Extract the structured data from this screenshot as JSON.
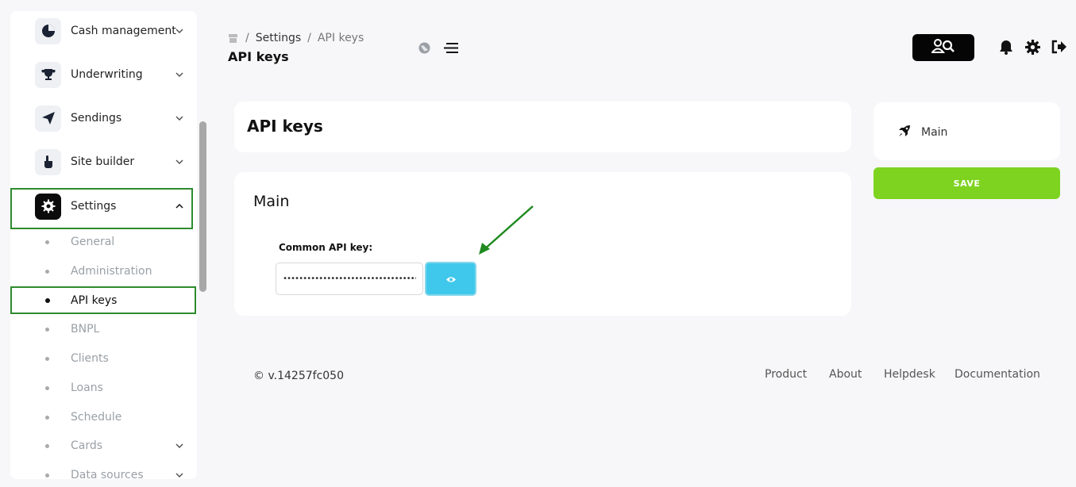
{
  "sidebar": {
    "menu": [
      {
        "label": "Cash management",
        "icon": "pie-chart-icon"
      },
      {
        "label": "Underwriting",
        "icon": "trophy-icon"
      },
      {
        "label": "Sendings",
        "icon": "paper-plane-icon"
      },
      {
        "label": "Site builder",
        "icon": "pointer-hand-icon"
      },
      {
        "label": "Settings",
        "icon": "gear-icon"
      }
    ],
    "settings_items": [
      {
        "label": "General"
      },
      {
        "label": "Administration"
      },
      {
        "label": "API keys"
      },
      {
        "label": "BNPL"
      },
      {
        "label": "Clients"
      },
      {
        "label": "Loans"
      },
      {
        "label": "Schedule"
      },
      {
        "label": "Cards"
      },
      {
        "label": "Data sources"
      }
    ]
  },
  "header": {
    "breadcrumb": [
      "Settings",
      "API keys"
    ],
    "title": "API keys"
  },
  "main": {
    "card_title": "API keys",
    "section_title": "Main",
    "api_key_label": "Common API key:",
    "api_key_value": "••••••••••••••••••••••••••••••••••••"
  },
  "side_panel": {
    "item_label": "Main",
    "save_label": "SAVE"
  },
  "footer": {
    "version": "© v.14257fc050",
    "links": [
      "Product",
      "About",
      "Helpdesk",
      "Documentation"
    ]
  },
  "colors": {
    "save": "#7ed321",
    "eye_button": "#3fc8ec",
    "highlight": "#2e8b2e"
  }
}
